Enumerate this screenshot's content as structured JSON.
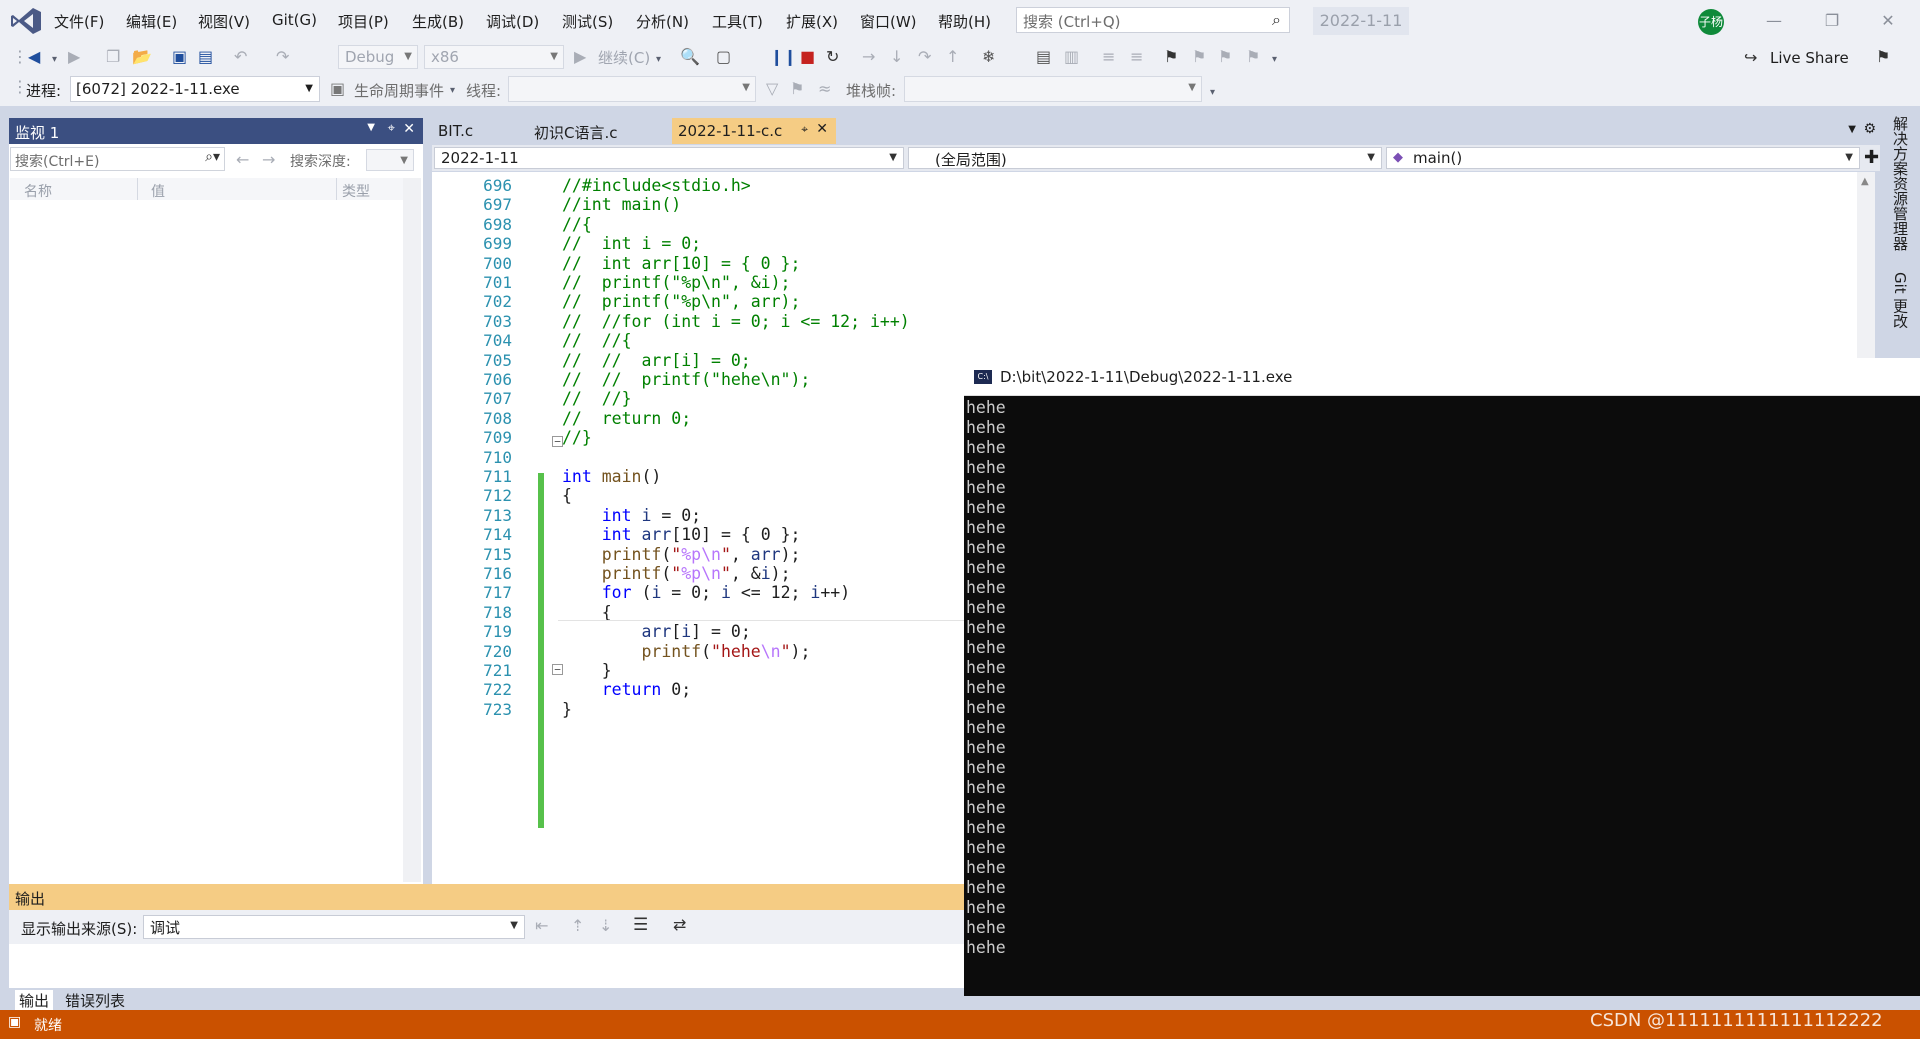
{
  "menubar": {
    "items": [
      "文件(F)",
      "编辑(E)",
      "视图(V)",
      "Git(G)",
      "项目(P)",
      "生成(B)",
      "调试(D)",
      "测试(S)",
      "分析(N)",
      "工具(T)",
      "扩展(X)",
      "窗口(W)",
      "帮助(H)"
    ],
    "search_placeholder": "搜索 (Ctrl+Q)",
    "solution_title": "2022-1-11",
    "avatar_text": "子杨"
  },
  "toolbar": {
    "config": "Debug",
    "platform": "x86",
    "continue_label": "继续(C)",
    "live_share": "Live Share",
    "process_label": "进程:",
    "process_value": "[6072] 2022-1-11.exe",
    "lifecycle_label": "生命周期事件",
    "thread_label": "线程:",
    "stackframe_label": "堆栈帧:"
  },
  "watch": {
    "title": "监视 1",
    "search_placeholder": "搜索(Ctrl+E)",
    "depth_label": "搜索深度:",
    "columns": [
      "名称",
      "值",
      "类型"
    ]
  },
  "editor": {
    "tabs": [
      "BIT.c",
      "初识C语言.c",
      "2022-1-11-c.c"
    ],
    "active_tab": 2,
    "nav_project": "2022-1-11",
    "nav_scope": "(全局范围)",
    "nav_member": "main()",
    "line_numbers": [
      "696",
      "697",
      "698",
      "699",
      "700",
      "701",
      "702",
      "703",
      "704",
      "705",
      "706",
      "707",
      "708",
      "709",
      "710",
      "711",
      "712",
      "713",
      "714",
      "715",
      "716",
      "717",
      "718",
      "719",
      "720",
      "721",
      "722",
      "723"
    ],
    "code_lines": [
      "//#include<stdio.h>",
      "//int main()",
      "//{",
      "//  int i = 0;",
      "//  int arr[10] = { 0 };",
      "//  printf(\"%p\\n\", &i);",
      "//  printf(\"%p\\n\", arr);",
      "//  //for (int i = 0; i <= 12; i++)",
      "//  //{",
      "//  //  arr[i] = 0;",
      "//  //  printf(\"hehe\\n\");",
      "//  //}",
      "//  return 0;",
      "//}",
      "",
      "int main()",
      "{",
      "    int i = 0;",
      "    int arr[10] = { 0 };",
      "    printf(\"%p\\n\", arr);",
      "    printf(\"%p\\n\", &i);",
      "    for (i = 0; i <= 12; i++)",
      "    {",
      "        arr[i] = 0;",
      "        printf(\"hehe\\n\");",
      "    }",
      "    return 0;",
      "}"
    ]
  },
  "rightbar": {
    "items": [
      "解决方案资源管理器",
      "Git 更改"
    ]
  },
  "output": {
    "title": "输出",
    "source_label": "显示输出来源(S):",
    "source_value": "调试",
    "tabs": [
      "输出",
      "错误列表"
    ]
  },
  "statusbar": {
    "text": "就绪"
  },
  "console": {
    "title": "D:\\bit\\2022-1-11\\Debug\\2022-1-11.exe",
    "icon_text": "C:\\",
    "lines": [
      "hehe",
      "hehe",
      "hehe",
      "hehe",
      "hehe",
      "hehe",
      "hehe",
      "hehe",
      "hehe",
      "hehe",
      "hehe",
      "hehe",
      "hehe",
      "hehe",
      "hehe",
      "hehe",
      "hehe",
      "hehe",
      "hehe",
      "hehe",
      "hehe",
      "hehe",
      "hehe",
      "hehe",
      "hehe",
      "hehe",
      "hehe",
      "hehe"
    ]
  },
  "watermark": "CSDN @1111111111111112222"
}
